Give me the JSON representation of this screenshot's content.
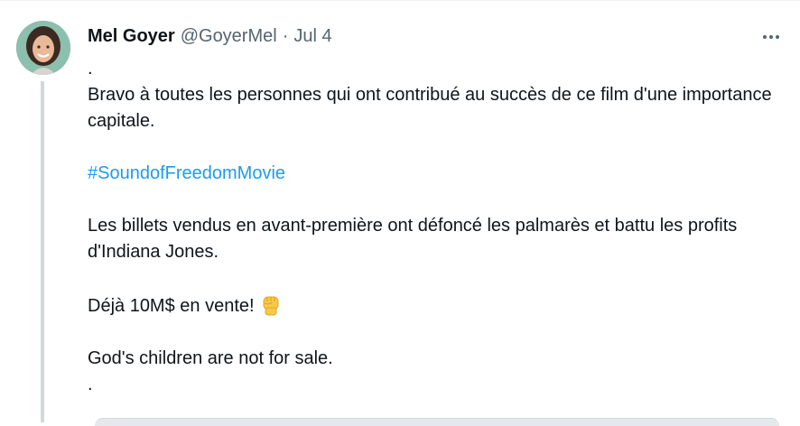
{
  "tweet": {
    "author_name": "Mel Goyer",
    "author_handle": "@GoyerMel",
    "separator": "·",
    "date": "Jul 4",
    "more_icon": "more-horizontal-icon",
    "lines": {
      "dot_top": ".",
      "paragraph_1": "Bravo à toutes les personnes qui ont contribué au succès de ce film d'une importance capitale.",
      "hashtag": "#SoundofFreedomMovie",
      "paragraph_2": "Les billets vendus en avant-première ont défoncé les palmarès et battu les profits d'Indiana Jones.",
      "paragraph_3": "Déjà 10M$ en vente!",
      "paragraph_3_emoji": "raised-fist-emoji",
      "paragraph_4": "God's children are not for sale.",
      "dot_bottom": "."
    }
  },
  "colors": {
    "hashtag": "#1d9bf0",
    "secondary_text": "#536471",
    "primary_text": "#0f1419",
    "thread_line": "#cfd9de"
  }
}
